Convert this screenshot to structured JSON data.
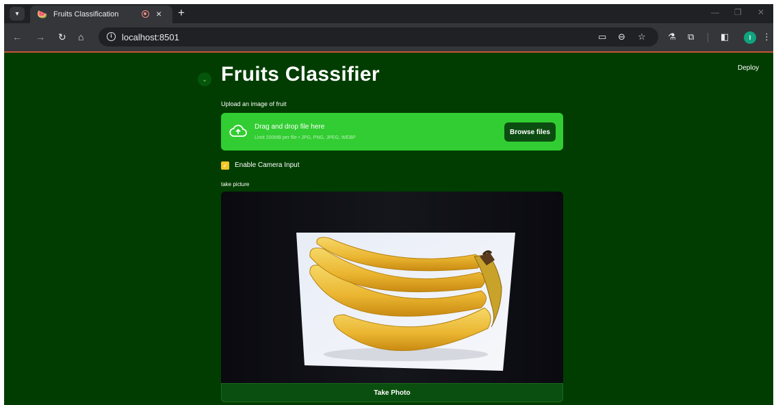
{
  "browser": {
    "tab_title": "Fruits Classification",
    "tab_favicon": "🍉",
    "tab_menu_icon": "chevron-down-icon",
    "url": "localhost:8501",
    "profile_initial": "I"
  },
  "app": {
    "deploy_label": "Deploy",
    "title": "Fruits Classifier",
    "upload": {
      "label": "Upload an image of fruit",
      "drop_title": "Drag and drop file here",
      "drop_hint": "Limit 200MB per file • JPG, PNG, JPEG, WEBP",
      "browse_label": "Browse files"
    },
    "camera_toggle": {
      "label": "Enable Camera Input",
      "checked": true
    },
    "camera": {
      "label": "take picture",
      "take_photo_label": "Take Photo"
    }
  },
  "colors": {
    "app_background": "#013d00",
    "dropzone": "#32cd32",
    "checkbox": "#f3c622",
    "button": "#0b4d10"
  }
}
